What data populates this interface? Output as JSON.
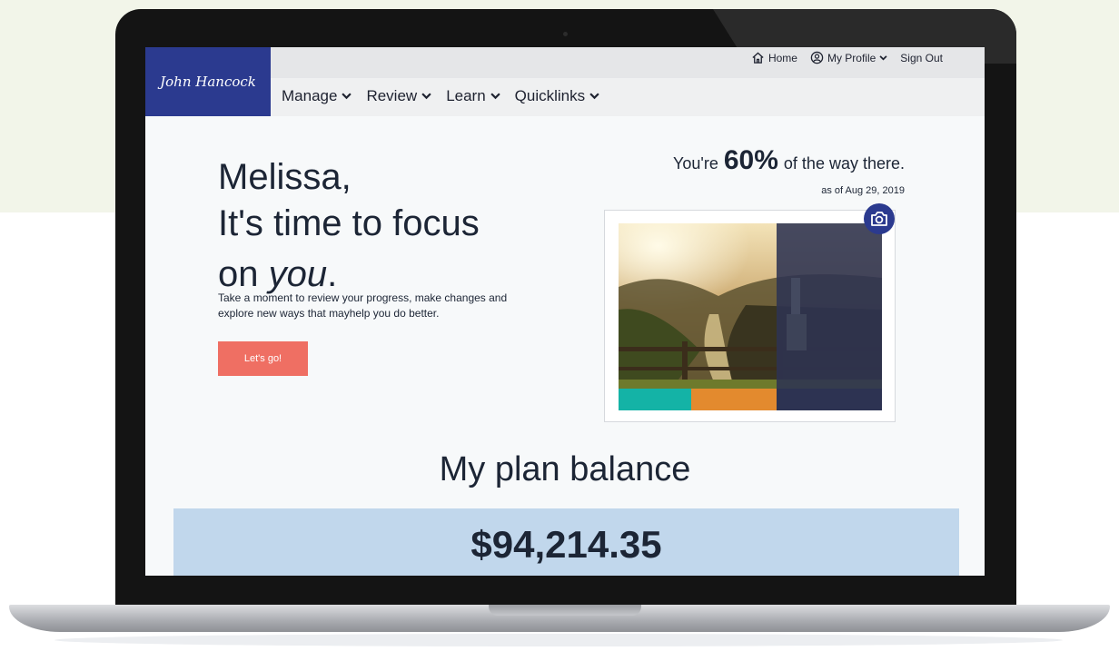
{
  "brand": {
    "logo_text": "John Hancock",
    "primary_color": "#2b3a8f",
    "accent_color": "#ef6f63"
  },
  "header": {
    "utility_links": [
      {
        "label": "Home",
        "icon": "home-icon"
      },
      {
        "label": "My Profile",
        "icon": "user-circle-icon",
        "dropdown": true
      },
      {
        "label": "Sign Out"
      }
    ],
    "nav": [
      {
        "label": "Manage"
      },
      {
        "label": "Review"
      },
      {
        "label": "Learn"
      },
      {
        "label": "Quicklinks"
      }
    ]
  },
  "hero": {
    "name_line": "Melissa,",
    "line2": "It's time to focus",
    "line3_prefix": "on ",
    "line3_emphasis": "you",
    "line3_suffix": ".",
    "description": "Take a moment to review your progress, make changes and explore new ways that mayhelp you do better.",
    "cta_label": "Let's go!"
  },
  "progress": {
    "prefix": "You're",
    "percent": "60%",
    "suffix": "of the way there.",
    "as_of": "as of Aug 29, 2019",
    "progress_segment_colors": [
      "#14b3a6",
      "#e38a2e",
      "#2d3352"
    ],
    "camera_icon": "camera-icon"
  },
  "balance": {
    "title": "My plan balance",
    "amount": "$94,214.35",
    "box_color": "#c1d7ec"
  }
}
